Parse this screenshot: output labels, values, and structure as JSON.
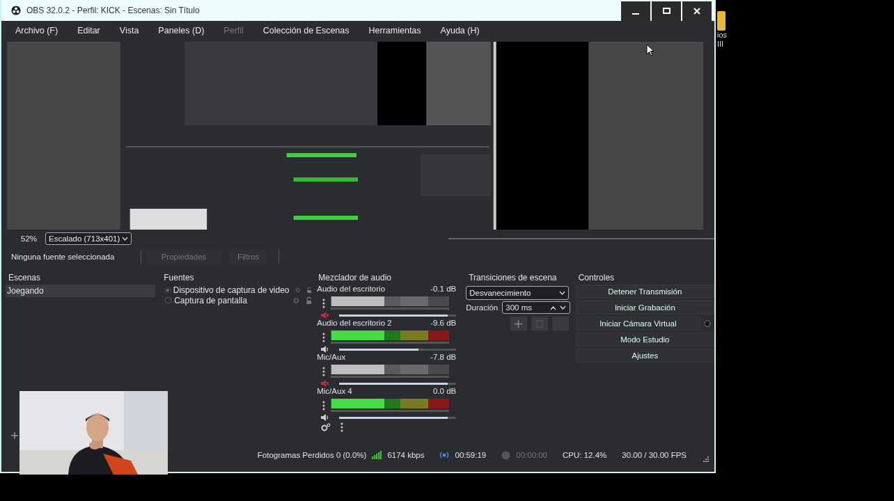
{
  "window": {
    "title": "OBS 32.0.2 - Perfil: KICK - Escenas: Sin Título"
  },
  "menu": [
    {
      "label": "Archivo (F)",
      "disabled": false
    },
    {
      "label": "Editar",
      "disabled": false
    },
    {
      "label": "Vista",
      "disabled": false
    },
    {
      "label": "Paneles (D)",
      "disabled": false
    },
    {
      "label": "Perfil",
      "disabled": true
    },
    {
      "label": "Colección de Escenas",
      "disabled": false
    },
    {
      "label": "Herramientas",
      "disabled": false
    },
    {
      "label": "Ayuda (H)",
      "disabled": false
    }
  ],
  "zoom": {
    "percent": "52%",
    "scale": "Escalado (713x401)"
  },
  "source_bar": {
    "status": "Ninguna fuente seleccionada",
    "buttons": [
      {
        "label": "Propiedades",
        "disabled": true
      },
      {
        "label": "Filtros",
        "disabled": true
      }
    ]
  },
  "scenes": {
    "title": "Escenas",
    "items": [
      {
        "label": "Joegando",
        "selected": true
      }
    ]
  },
  "sources": {
    "title": "Fuentes",
    "items": [
      {
        "label": "Dispositivo de captura de video",
        "kind": "camera",
        "visible": true,
        "locked": false
      },
      {
        "label": "Captura de pantalla",
        "kind": "screen",
        "visible": true,
        "locked": false
      }
    ]
  },
  "mixer": {
    "title": "Mezclador de audio",
    "channels": [
      {
        "name": "Audio del escritorio",
        "reading": "-0.1 dB",
        "muted": true,
        "level": 0.93
      },
      {
        "name": "Audio del escritorio 2",
        "reading": "-9.6 dB",
        "muted": false,
        "level": 0.68
      },
      {
        "name": "Mic/Aux",
        "reading": "-7.8 dB",
        "muted": true,
        "level": 0.93
      },
      {
        "name": "Mic/Aux 4",
        "reading": "0.0 dB",
        "muted": false,
        "level": 0.93
      }
    ]
  },
  "transitions": {
    "title": "Transiciones de escena",
    "transition": "Desvanecimiento",
    "duration_label": "Duración",
    "duration": "300 ms"
  },
  "controls": {
    "title": "Controles",
    "buttons": [
      {
        "label": "Detener Transmisión",
        "kind": "plain"
      },
      {
        "label": "Iniciar Grabación",
        "kind": "plain"
      },
      {
        "label": "Iniciar Cámara Virtual",
        "kind": "with-settings"
      },
      {
        "label": "Modo Estudio",
        "kind": "plain"
      },
      {
        "label": "Ajustes",
        "kind": "plain"
      }
    ]
  },
  "status_bar": {
    "dropped": "Fotogramas Perdidos 0 (0.0%)",
    "bitrate": "6174 kbps",
    "streaming": true,
    "stream_time": "00:59:19",
    "recording": false,
    "recording_time": "00:00:00",
    "cpu": "CPU: 12.4%",
    "fps": "30.00 / 30.00 FPS"
  },
  "desktop": {
    "labels": [
      "ios",
      "III"
    ]
  }
}
